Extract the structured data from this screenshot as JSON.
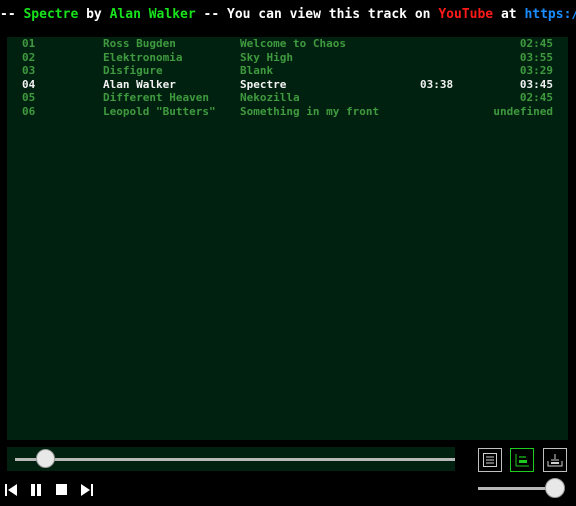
{
  "now_playing": {
    "prefix": "-- ",
    "track": "Spectre",
    "by_word": " by ",
    "artist": "Alan Walker",
    "middle": " -- You can view this track on ",
    "service": "YouTube",
    "at_word": " at ",
    "link_start": "https://w"
  },
  "playlist": {
    "rows": [
      {
        "num": "01",
        "artist": "Ross Bugden",
        "title": "Welcome to Chaos",
        "elapsed": "",
        "duration": "02:45",
        "active": false
      },
      {
        "num": "02",
        "artist": "Elektronomia",
        "title": "Sky High",
        "elapsed": "",
        "duration": "03:55",
        "active": false
      },
      {
        "num": "03",
        "artist": "Disfigure",
        "title": "Blank",
        "elapsed": "",
        "duration": "03:29",
        "active": false
      },
      {
        "num": "04",
        "artist": "Alan Walker",
        "title": "Spectre",
        "elapsed": "03:38",
        "duration": "03:45",
        "active": true
      },
      {
        "num": "05",
        "artist": "Different Heaven",
        "title": "Nekozilla",
        "elapsed": "",
        "duration": "02:45",
        "active": false
      },
      {
        "num": "06",
        "artist": "Leopold \"Butters\"",
        "title": "Something in my front",
        "elapsed": "",
        "duration": "undefined",
        "active": false
      }
    ]
  },
  "player": {
    "seek_fraction": 0.05,
    "volume_fraction": 1.0,
    "active_mode_icon": "playlist-icon"
  },
  "colors": {
    "accent_green": "#17e31c",
    "youtube_red": "#ff1a1a",
    "link_blue": "#1a8cff",
    "panel_bg": "#00210f",
    "inactive_text": "#3f9a3f"
  }
}
